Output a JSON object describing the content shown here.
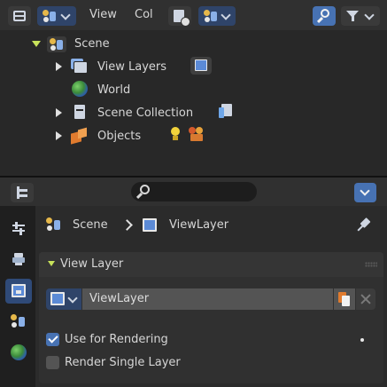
{
  "header": {
    "view_menu": "View",
    "col_menu": "Col"
  },
  "outliner": {
    "items": [
      {
        "label": "Scene"
      },
      {
        "label": "View Layers"
      },
      {
        "label": "World"
      },
      {
        "label": "Scene Collection"
      },
      {
        "label": "Objects"
      }
    ]
  },
  "properties": {
    "search_placeholder": "",
    "breadcrumb": {
      "scene": "Scene",
      "view_layer": "ViewLayer"
    },
    "panel_title": "View Layer",
    "view_layer_name": "ViewLayer",
    "use_for_rendering": {
      "label": "Use for Rendering",
      "checked": true
    },
    "render_single_layer": {
      "label": "Render Single Layer",
      "checked": false
    }
  },
  "colors": {
    "accent_blue": "#4772b3",
    "panel_bg": "#2b2b2b",
    "header_bg": "#303030",
    "scene_green": "#c8e35b"
  }
}
